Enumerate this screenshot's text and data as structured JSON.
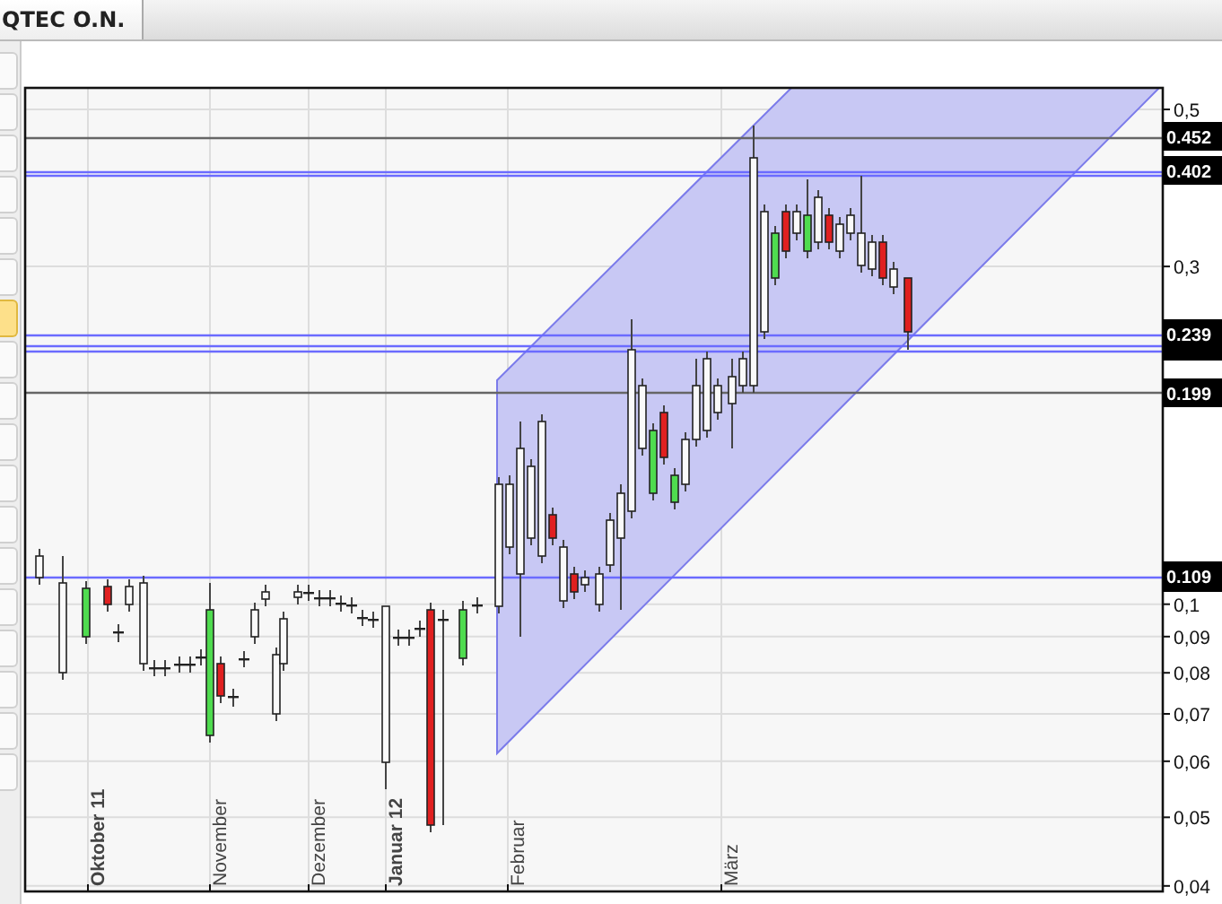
{
  "tabs": [
    {
      "label": "QTEC O.N.",
      "selected": true
    }
  ],
  "sidebar": {
    "buttons": [
      {
        "selected": false
      },
      {
        "selected": false
      },
      {
        "selected": false
      },
      {
        "selected": false
      },
      {
        "selected": false
      },
      {
        "selected": false
      },
      {
        "selected": true
      },
      {
        "selected": false
      },
      {
        "selected": false
      },
      {
        "selected": false
      },
      {
        "selected": false
      },
      {
        "selected": false
      },
      {
        "selected": false
      },
      {
        "selected": false
      },
      {
        "selected": false
      },
      {
        "selected": false
      },
      {
        "selected": false
      },
      {
        "selected": false
      }
    ]
  },
  "chart": {
    "price_tags": [
      {
        "label": "0.452"
      },
      {
        "label": "0.402"
      },
      {
        "label": "0.239"
      },
      {
        "label": "0.199"
      },
      {
        "label": "0.109"
      }
    ],
    "y_ticks": [
      "0,5",
      "0,3",
      "0,1",
      "0,09",
      "0,08",
      "0,07",
      "0,06",
      "0,05",
      "0,04"
    ],
    "x_labels": [
      {
        "text": "Oktober 11",
        "kind": "year"
      },
      {
        "text": "November",
        "kind": "month"
      },
      {
        "text": "Dezember",
        "kind": "month"
      },
      {
        "text": "Januar 12",
        "kind": "year"
      },
      {
        "text": "Februar",
        "kind": "month"
      },
      {
        "text": "März",
        "kind": "month"
      }
    ]
  }
}
